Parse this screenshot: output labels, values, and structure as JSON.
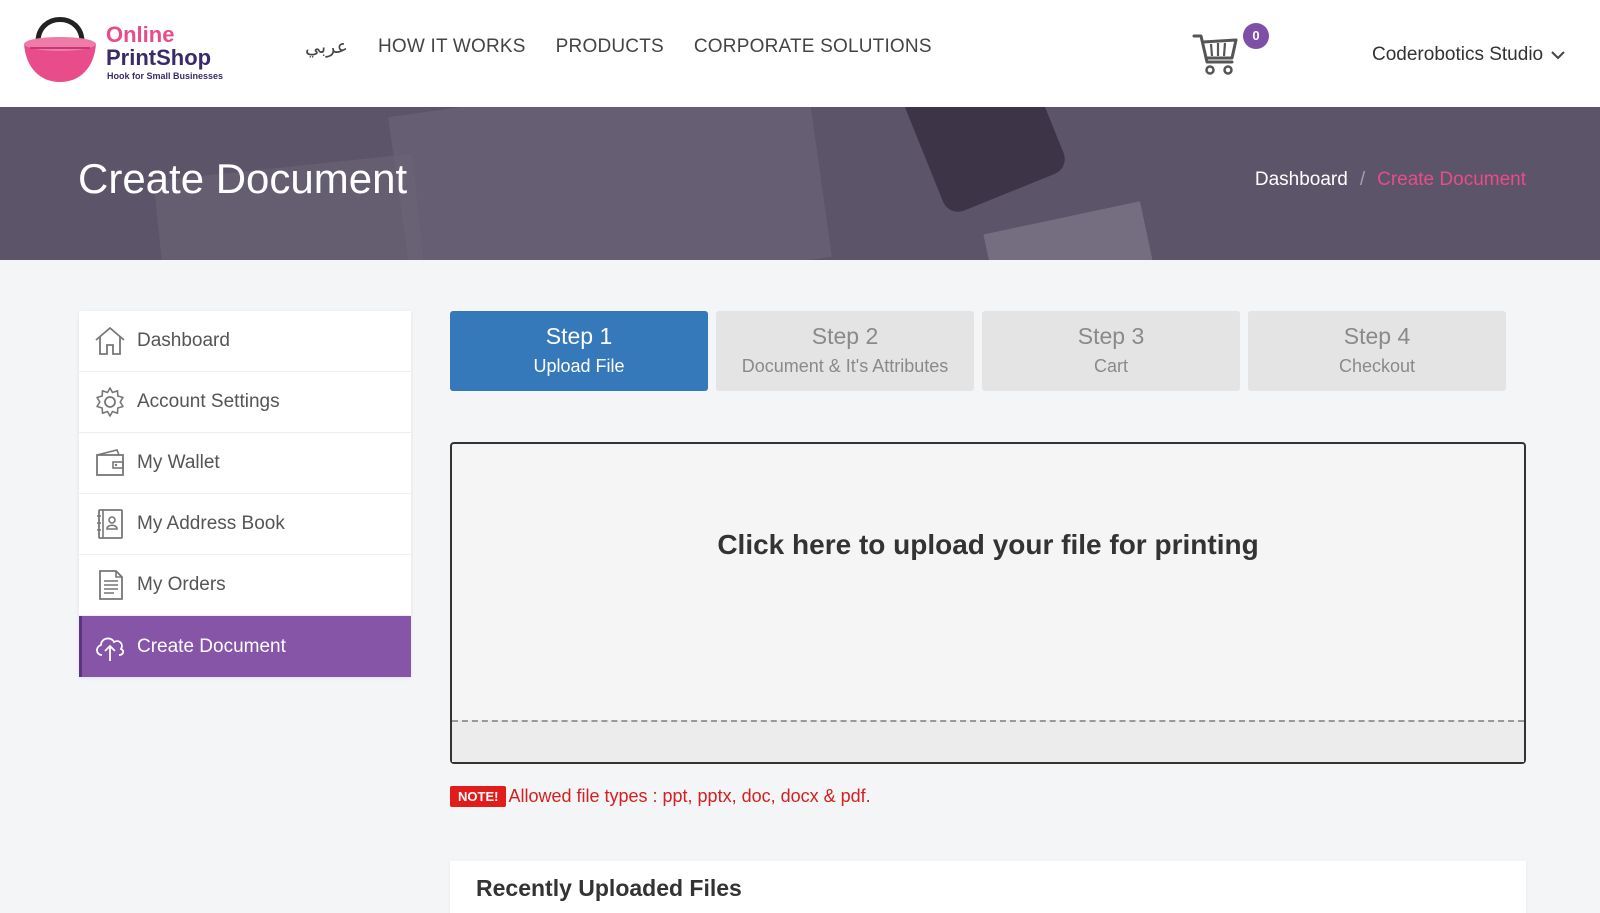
{
  "header": {
    "logo": {
      "line1": "Online",
      "line2": "PrintShop",
      "tagline": "Hook for Small Businesses"
    },
    "nav": [
      {
        "label": "عربي"
      },
      {
        "label": "HOW IT WORKS"
      },
      {
        "label": "PRODUCTS"
      },
      {
        "label": "CORPORATE SOLUTIONS"
      }
    ],
    "cart_count": "0",
    "user_name": "Coderobotics Studio"
  },
  "banner": {
    "title": "Create Document",
    "breadcrumb": {
      "home": "Dashboard",
      "separator": "/",
      "current": "Create Document"
    }
  },
  "sidebar": {
    "items": [
      {
        "label": "Dashboard",
        "icon": "home-icon"
      },
      {
        "label": "Account Settings",
        "icon": "gear-icon"
      },
      {
        "label": "My Wallet",
        "icon": "wallet-icon"
      },
      {
        "label": "My Address Book",
        "icon": "address-book-icon"
      },
      {
        "label": "My Orders",
        "icon": "document-list-icon"
      },
      {
        "label": "Create Document",
        "icon": "cloud-upload-icon",
        "active": true
      }
    ]
  },
  "steps": [
    {
      "title": "Step 1",
      "subtitle": "Upload File",
      "active": true
    },
    {
      "title": "Step 2",
      "subtitle": "Document & It's Attributes"
    },
    {
      "title": "Step 3",
      "subtitle": "Cart"
    },
    {
      "title": "Step 4",
      "subtitle": "Checkout"
    }
  ],
  "upload": {
    "prompt": "Click here to upload your file for printing"
  },
  "note": {
    "badge": "NOTE!",
    "text": "Allowed file types : ppt, pptx, doc, docx & pdf."
  },
  "recent": {
    "title": "Recently Uploaded Files"
  },
  "colors": {
    "accent_purple": "#8655a8",
    "step_active": "#3679ba",
    "pink": "#e84c8b",
    "note_red": "#e21b1b"
  }
}
